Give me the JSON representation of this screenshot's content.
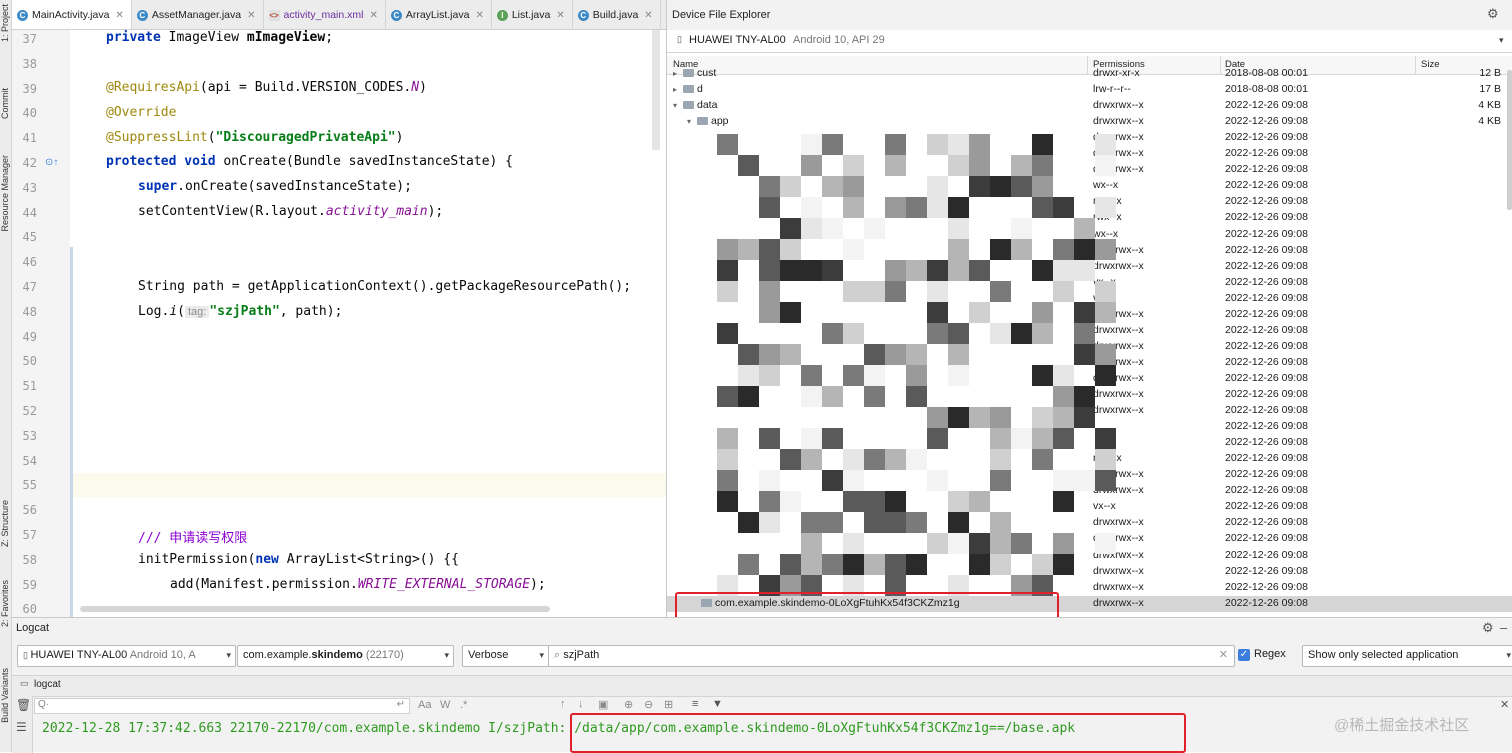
{
  "tool_strip": {
    "project": "1: Project",
    "commit": "Commit",
    "resource_manager": "Resource Manager",
    "structure": "Z: Structure",
    "favorites": "2: Favorites",
    "build_variants": "Build Variants"
  },
  "tabs": [
    {
      "label": "MainActivity.java",
      "icon": "class-icon",
      "active": true
    },
    {
      "label": "AssetManager.java",
      "icon": "class-icon",
      "active": false
    },
    {
      "label": "activity_main.xml",
      "icon": "xml-icon",
      "active": false
    },
    {
      "label": "ArrayList.java",
      "icon": "class-icon",
      "active": false
    },
    {
      "label": "List.java",
      "icon": "interface-icon",
      "active": false
    },
    {
      "label": "Build.java",
      "icon": "class-icon",
      "active": false
    }
  ],
  "editor": {
    "line_numbers": [
      "37",
      "38",
      "39",
      "40",
      "41",
      "42",
      "43",
      "44",
      "45",
      "46",
      "47",
      "48",
      "49",
      "50",
      "51",
      "52",
      "53",
      "54",
      "55",
      "56",
      "57",
      "58",
      "59",
      "60"
    ],
    "l37": {
      "a": "private ",
      "b": "ImageView ",
      "c": "mImageView",
      "d": ";"
    },
    "l39": {
      "a": "@RequiresApi",
      "b": "(api = Build.VERSION_CODES.",
      "c": "N",
      "d": ")"
    },
    "l40": "@Override",
    "l41": {
      "a": "@SuppressLint",
      "b": "(",
      "c": "\"DiscouragedPrivateApi\"",
      "d": ")"
    },
    "l42": {
      "a": "protected ",
      "b": "void ",
      "c": "onCreate(Bundle savedInstanceState) {"
    },
    "l43": {
      "a": "super",
      "b": ".onCreate(savedInstanceState);"
    },
    "l44": {
      "a": "setContentView(R.layout.",
      "b": "activity_main",
      "c": ");"
    },
    "l47": "String path = getApplicationContext().getPackageResourcePath();",
    "l48": {
      "a": "Log.",
      "b": "i",
      "c": "(",
      "hint": "tag:",
      "d": "\"szjPath\"",
      "e": ", path);"
    },
    "l57": "/// 申请读写权限",
    "l58": {
      "a": "initPermission(",
      "b": "new ",
      "c": "ArrayList<String>() {{"
    },
    "l59": {
      "a": "add(Manifest.permission.",
      "b": "WRITE_EXTERNAL_STORAGE",
      "c": ");"
    }
  },
  "dfe": {
    "title": "Device File Explorer",
    "device": "HUAWEI TNY-AL00",
    "device_info": "Android 10, API 29",
    "columns": {
      "name": "Name",
      "permissions": "Permissions",
      "date": "Date",
      "size": "Size"
    },
    "rows": [
      {
        "name": "cust",
        "perm": "drwxr-xr-x",
        "date": "2018-08-08 00:01",
        "size": "12 B",
        "indent": 0,
        "arrow": "▸"
      },
      {
        "name": "d",
        "perm": "lrw-r--r--",
        "date": "2018-08-08 00:01",
        "size": "17 B",
        "indent": 0,
        "arrow": "▸"
      },
      {
        "name": "data",
        "perm": "drwxrwx--x",
        "date": "2022-12-26 09:08",
        "size": "4 KB",
        "indent": 0,
        "arrow": "▾"
      },
      {
        "name": "app",
        "perm": "drwxrwx--x",
        "date": "2022-12-26 09:08",
        "size": "4 KB",
        "indent": 1,
        "arrow": "▾"
      },
      {
        "name": "",
        "perm": "drwxrwx--x",
        "date": "2022-12-26 09:08",
        "size": ""
      },
      {
        "name": "",
        "perm": "drwxrwx--x",
        "date": "2022-12-26 09:08",
        "size": ""
      },
      {
        "name": "",
        "perm": "drwxrwx--x",
        "date": "2022-12-26 09:08",
        "size": ""
      },
      {
        "name": "",
        "perm": "wx--x",
        "date": "2022-12-26 09:08",
        "size": ""
      },
      {
        "name": "",
        "perm": "rwx--x",
        "date": "2022-12-26 09:08",
        "size": ""
      },
      {
        "name": "",
        "perm": "rwx--x",
        "date": "2022-12-26 09:08",
        "size": ""
      },
      {
        "name": "",
        "perm": "wx--x",
        "date": "2022-12-26 09:08",
        "size": ""
      },
      {
        "name": "",
        "perm": "drwxrwx--x",
        "date": "2022-12-26 09:08",
        "size": ""
      },
      {
        "name": "",
        "perm": "drwxrwx--x",
        "date": "2022-12-26 09:08",
        "size": ""
      },
      {
        "name": "",
        "perm": "vx--x",
        "date": "2022-12-26 09:08",
        "size": ""
      },
      {
        "name": "",
        "perm": "vx--x",
        "date": "2022-12-26 09:08",
        "size": ""
      },
      {
        "name": "",
        "perm": "drwxrwx--x",
        "date": "2022-12-26 09:08",
        "size": ""
      },
      {
        "name": "",
        "perm": "drwxrwx--x",
        "date": "2022-12-26 09:08",
        "size": ""
      },
      {
        "name": "",
        "perm": "drwxrwx--x",
        "date": "2022-12-26 09:08",
        "size": ""
      },
      {
        "name": "",
        "perm": "drwxrwx--x",
        "date": "2022-12-26 09:08",
        "size": ""
      },
      {
        "name": "",
        "perm": "drwxrwx--x",
        "date": "2022-12-26 09:08",
        "size": ""
      },
      {
        "name": "",
        "perm": "drwxrwx--x",
        "date": "2022-12-26 09:08",
        "size": ""
      },
      {
        "name": "",
        "perm": "drwxrwx--x",
        "date": "2022-12-26 09:08",
        "size": ""
      },
      {
        "name": "",
        "perm": "",
        "date": "2022-12-26 09:08",
        "size": ""
      },
      {
        "name": "",
        "perm": "",
        "date": "2022-12-26 09:08",
        "size": ""
      },
      {
        "name": "",
        "perm": "rwx--x",
        "date": "2022-12-26 09:08",
        "size": ""
      },
      {
        "name": "",
        "perm": "drwxrwx--x",
        "date": "2022-12-26 09:08",
        "size": ""
      },
      {
        "name": "",
        "perm": "drwxrwx--x",
        "date": "2022-12-26 09:08",
        "size": ""
      },
      {
        "name": "",
        "perm": "vx--x",
        "date": "2022-12-26 09:08",
        "size": ""
      },
      {
        "name": "",
        "perm": "drwxrwx--x",
        "date": "2022-12-26 09:08",
        "size": ""
      },
      {
        "name": "",
        "perm": "drwxrwx--x",
        "date": "2022-12-26 09:08",
        "size": ""
      },
      {
        "name": "",
        "perm": "drwxrwx--x",
        "date": "2022-12-26 09:08",
        "size": ""
      },
      {
        "name": "",
        "perm": "drwxrwx--x",
        "date": "2022-12-26 09:08",
        "size": ""
      },
      {
        "name": "",
        "perm": "drwxrwx--x",
        "date": "2022-12-26 09:08",
        "size": ""
      },
      {
        "name": "com.example.skindemo-0LoXgFtuhKx54f3CKZmz1g",
        "perm": "drwxrwx--x",
        "date": "2022-12-26 09:08",
        "size": "",
        "indent": 2,
        "selected": true
      }
    ]
  },
  "logcat": {
    "title": "Logcat",
    "device": "HUAWEI TNY-AL00",
    "device_info": "Android 10, A",
    "process_pkg_prefix": "com.example.",
    "process_pkg_name": "skindemo",
    "process_pid": "(22170)",
    "level": "Verbose",
    "search": "szjPath",
    "regex_label": "Regex",
    "regex_checked": true,
    "filter": "Show only selected application",
    "tab": "logcat",
    "search_placeholder": "Q·",
    "line": "2022-12-28 17:37:42.663 22170-22170/com.example.skindemo I/szjPath: /data/app/com.example.skindemo-0LoXgFtuhKx54f3CKZmz1g==/base.apk"
  },
  "watermark": "@稀土掘金技术社区",
  "colors": {
    "highlight_box": "#e0202a",
    "log_text": "#2e9a1f",
    "keyword": "#0033b3",
    "annotation": "#9e880d",
    "string": "#067d17",
    "field": "#871094"
  }
}
